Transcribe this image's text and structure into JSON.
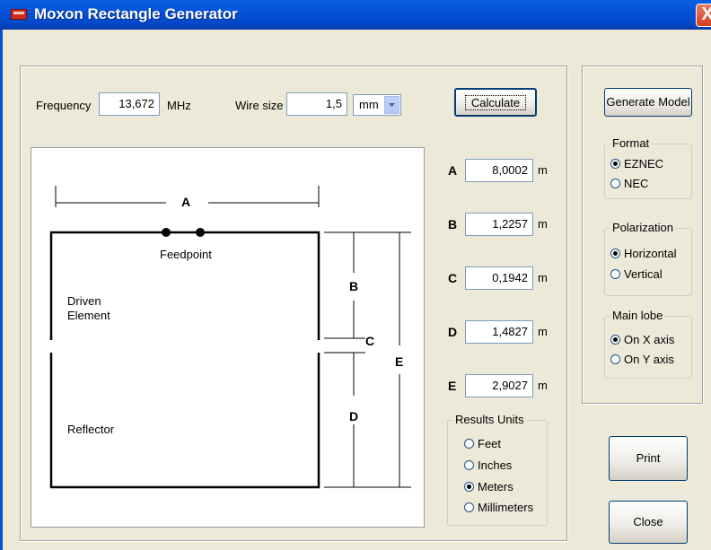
{
  "window": {
    "title": "Moxon Rectangle Generator",
    "close_glyph": "X"
  },
  "inputs": {
    "frequency_label": "Frequency",
    "frequency_value": "13,672",
    "frequency_unit": "MHz",
    "wire_label": "Wire size",
    "wire_value": "1,5",
    "wire_unit": "mm",
    "calculate": "Calculate"
  },
  "diagram": {
    "A": "A",
    "B": "B",
    "C": "C",
    "D": "D",
    "E": "E",
    "feedpoint": "Feedpoint",
    "driven_line1": "Driven",
    "driven_line2": "Element",
    "reflector": "Reflector"
  },
  "results": {
    "rows": [
      {
        "label": "A",
        "value": "8,0002",
        "unit": "m"
      },
      {
        "label": "B",
        "value": "1,2257",
        "unit": "m"
      },
      {
        "label": "C",
        "value": "0,1942",
        "unit": "m"
      },
      {
        "label": "D",
        "value": "1,4827",
        "unit": "m"
      },
      {
        "label": "E",
        "value": "2,9027",
        "unit": "m"
      }
    ],
    "units_group": "Results Units",
    "units": [
      "Feet",
      "Inches",
      "Meters",
      "Millimeters"
    ],
    "selected_unit": "Meters"
  },
  "model": {
    "generate": "Generate Model",
    "format_group": "Format",
    "format_options": [
      "EZNEC",
      "NEC"
    ],
    "polarization_group": "Polarization",
    "polarization_options": [
      "Horizontal",
      "Vertical"
    ],
    "lobe_group": "Main lobe",
    "lobe_options": [
      "On X axis",
      "On Y axis"
    ]
  },
  "buttons": {
    "print": "Print",
    "close": "Close"
  }
}
